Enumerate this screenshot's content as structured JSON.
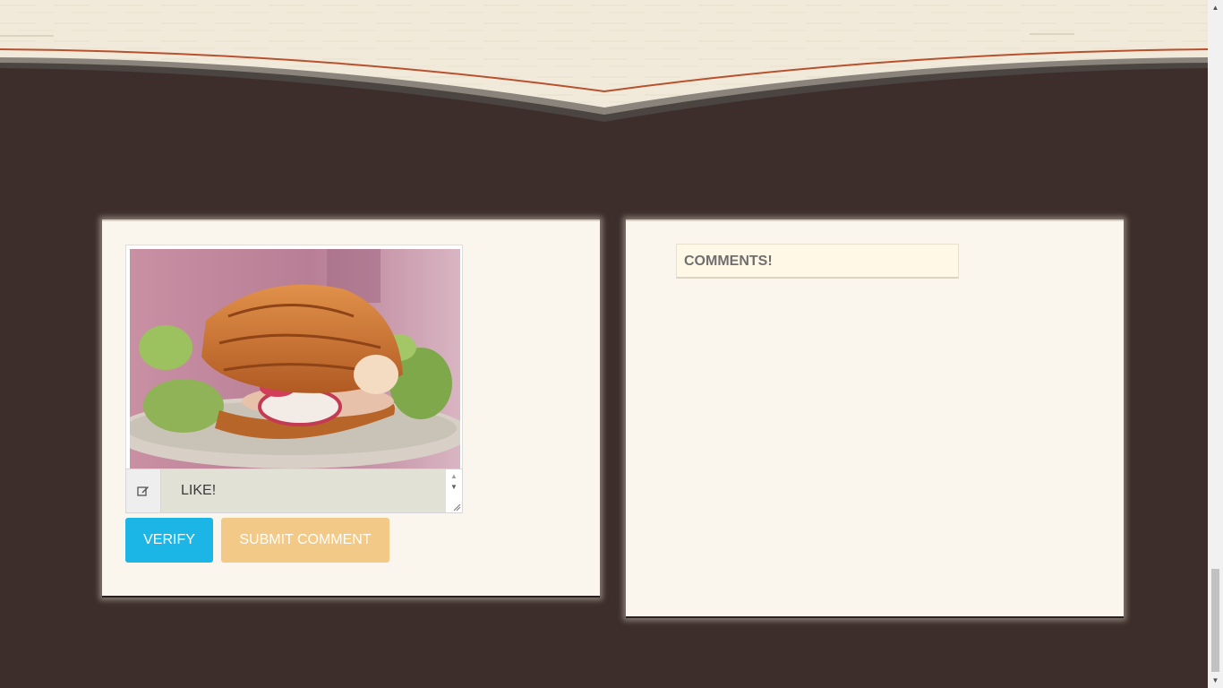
{
  "post": {
    "photo_alt": "croissant sandwich",
    "comment_value": "LIKE!"
  },
  "actions": {
    "verify_label": "VERIFY",
    "submit_label": "SUBMIT COMMENT"
  },
  "comments": {
    "heading": "COMMENTS!"
  },
  "colors": {
    "page_background": "#3d2e2b",
    "panel_background": "#faf6ee",
    "verify_button": "#1cb6e6",
    "submit_button": "#f2c987",
    "comments_heading_bg": "#fff8e6"
  },
  "icons": {
    "comment_field": "edit-icon"
  }
}
